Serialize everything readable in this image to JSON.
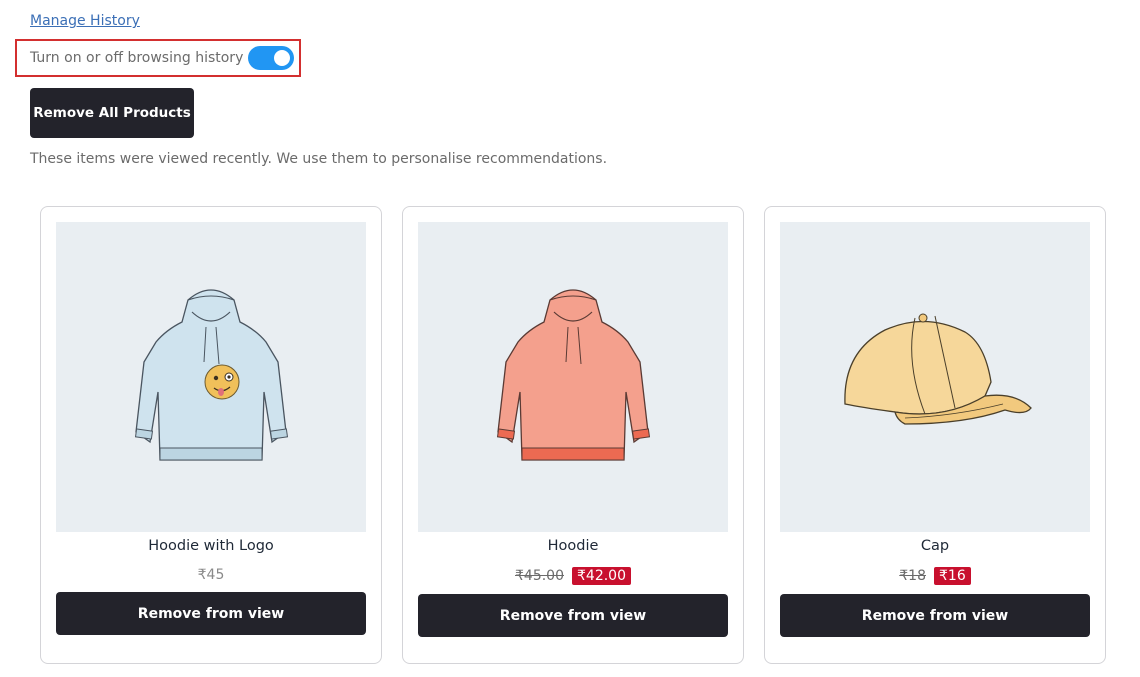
{
  "header": {
    "manage_history_link": "Manage History",
    "toggle_label": "Turn on or off browsing history",
    "toggle_on": true,
    "remove_all_label": "Remove All Products",
    "info_text": "These items were viewed recently. We use them to personalise recommendations."
  },
  "products": [
    {
      "name": "Hoodie with Logo",
      "price": "₹45",
      "remove_label": "Remove from view",
      "icon": "hoodie-with-logo-image",
      "color": "#cfe3ee"
    },
    {
      "name": "Hoodie",
      "old_price": "₹45.00",
      "sale_price": "₹42.00",
      "remove_label": "Remove from view",
      "icon": "hoodie-image",
      "color": "#f4a08d"
    },
    {
      "name": "Cap",
      "old_price": "₹18",
      "sale_price": "₹16",
      "remove_label": "Remove from view",
      "icon": "cap-image",
      "color": "#f6d79a"
    }
  ],
  "colors": {
    "accent": "#2196f3",
    "button_bg": "#23232b",
    "sale_bg": "#c8102e",
    "highlight_border": "#d32f2f",
    "thumb_bg": "#e9eef2"
  }
}
